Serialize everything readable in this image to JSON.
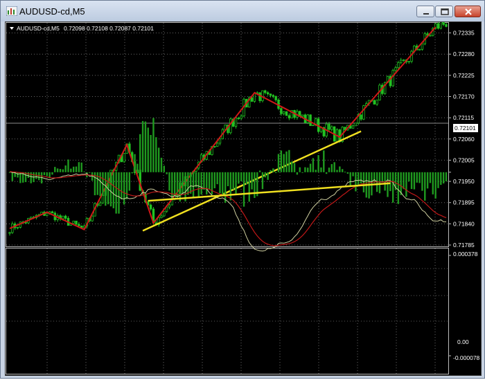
{
  "window": {
    "title": "AUDUSD-cd,M5"
  },
  "chart": {
    "header": {
      "symbol": "AUDUSD-cd,M5",
      "ohlc": "0.72098 0.72108 0.72087 0.72101"
    },
    "current_price": "0.72101",
    "price_labels": [
      "0.72335",
      "0.72280",
      "0.72225",
      "0.72170",
      "0.72115",
      "0.72060",
      "0.72005",
      "0.71950",
      "0.71895",
      "0.71840",
      "0.71785"
    ],
    "indicator_labels": [
      "0.000378",
      "0.00",
      "-0.000078"
    ],
    "colors": {
      "background": "#000000",
      "candles": "#22c322",
      "zigzag": "#d01818",
      "trendline": "#f0e020",
      "signal_line": "#d0d0a0",
      "indicator_ma": "#c01818",
      "histogram": "#1f9a1f",
      "price_badge": "#ffffff"
    }
  },
  "chart_data": {
    "type": "candlestick",
    "symbol": "AUDUSD-cd",
    "timeframe": "M5",
    "ylim": [
      0.71785,
      0.72345
    ],
    "zigzag": [
      {
        "i": 0,
        "price": 0.71828
      },
      {
        "i": 14,
        "price": 0.7187
      },
      {
        "i": 28,
        "price": 0.71825
      },
      {
        "i": 44,
        "price": 0.72045
      },
      {
        "i": 54,
        "price": 0.71842
      },
      {
        "i": 92,
        "price": 0.7218
      },
      {
        "i": 124,
        "price": 0.72065
      },
      {
        "i": 160,
        "price": 0.7235
      }
    ],
    "trendline_price": [
      {
        "i": 50,
        "price": 0.71822
      },
      {
        "i": 132,
        "price": 0.7208
      }
    ],
    "indicator": {
      "ylim": [
        -7.8e-05,
        0.000378
      ],
      "trendline": [
        {
          "i": 52,
          "value": 0.00013
        },
        {
          "i": 143,
          "value": 5e-05
        }
      ]
    }
  }
}
